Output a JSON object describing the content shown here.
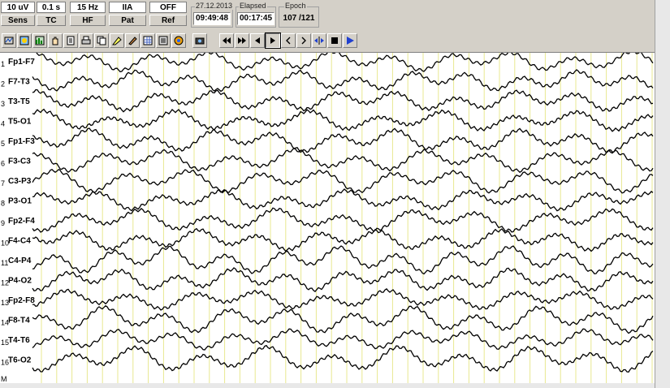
{
  "settings": {
    "sensitivity": {
      "value": "10 uV",
      "label": "Sens"
    },
    "time_constant": {
      "value": "0.1 s",
      "label": "TC"
    },
    "high_filter": {
      "value": "15 Hz",
      "label": "HF"
    },
    "patient": {
      "value": "IIA",
      "label": "Pat"
    },
    "reference": {
      "value": "OFF",
      "label": "Ref"
    }
  },
  "info": {
    "date": "27.12.2013",
    "time": "09:49:48",
    "elapsed_label": "Elapsed",
    "elapsed_value": "00:17:45",
    "epoch_label": "Epoch",
    "epoch_value": "107 /121"
  },
  "toolbar": {
    "tools": [
      "montage-icon",
      "map-icon",
      "spectrum-icon",
      "hand-icon",
      "notes-icon",
      "print-icon",
      "copy-icon",
      "marker-icon",
      "pen-icon",
      "grid-icon",
      "list-icon",
      "color-icon",
      "camera-icon"
    ],
    "nav": [
      "fast-rewind-icon",
      "fast-forward-icon",
      "step-back-icon",
      "play-icon",
      "prev-icon",
      "next-icon",
      "split-icon",
      "stop-icon",
      "forward-play-icon"
    ]
  },
  "channels": [
    {
      "num": "1",
      "label": "Fp1-F7"
    },
    {
      "num": "2",
      "label": "F7-T3"
    },
    {
      "num": "3",
      "label": "T3-T5"
    },
    {
      "num": "4",
      "label": "T5-O1"
    },
    {
      "num": "5",
      "label": "Fp1-F3"
    },
    {
      "num": "6",
      "label": "F3-C3"
    },
    {
      "num": "7",
      "label": "C3-P3"
    },
    {
      "num": "8",
      "label": "P3-O1"
    },
    {
      "num": "9",
      "label": "Fp2-F4"
    },
    {
      "num": "10",
      "label": "F4-C4"
    },
    {
      "num": "11",
      "label": "C4-P4"
    },
    {
      "num": "12",
      "label": "P4-O2"
    },
    {
      "num": "13",
      "label": "Fp2-F8"
    },
    {
      "num": "14",
      "label": "F8-T4"
    },
    {
      "num": "15",
      "label": "T4-T6"
    },
    {
      "num": "16",
      "label": "T6-O2"
    }
  ],
  "marker_label": "M",
  "colors": {
    "grid_line": "#e8e890",
    "trace": "#000000",
    "background": "#ffffff",
    "panel": "#d4d0c8",
    "play_blue": "#2040d0"
  }
}
